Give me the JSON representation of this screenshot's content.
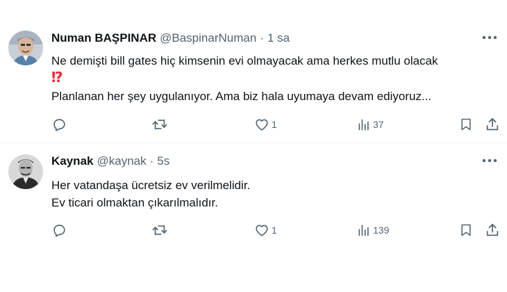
{
  "tweets": [
    {
      "display_name": "Numan BAŞPINAR",
      "handle": "@BaspinarNuman",
      "separator": "·",
      "time": "1 sa",
      "lines": [
        "Ne demişti bill gates hiç kimsenin evi olmayacak ama herkes mutlu olacak",
        "⁉",
        "Planlanan her şey uygulanıyor.  Ama biz hala uyumaya devam ediyoruz..."
      ],
      "likes": "1",
      "views": "37"
    },
    {
      "display_name": "Kaynak",
      "handle": "@kaynak",
      "separator": "·",
      "time": "5s",
      "lines": [
        "Her vatandaşa ücretsiz ev verilmelidir.",
        "Ev ticari olmaktan çıkarılmalıdır."
      ],
      "likes": "1",
      "views": "139"
    }
  ],
  "icons": {
    "reply": "reply-icon",
    "repost": "repost-icon",
    "like": "heart-icon",
    "views": "views-icon",
    "bookmark": "bookmark-icon",
    "share": "share-icon",
    "more": "more-icon"
  },
  "colors": {
    "text": "#0f1419",
    "secondary": "#536471",
    "interrobang": "#f4212e",
    "divider": "#eff3f4"
  }
}
